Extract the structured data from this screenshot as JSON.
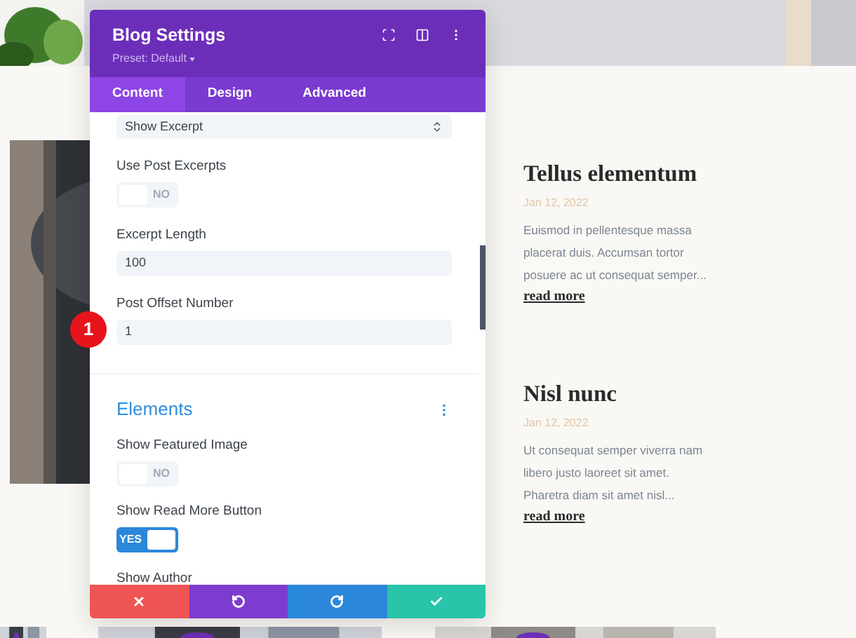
{
  "posts": [
    {
      "title": "Tellus elementum",
      "date": "Jan 12, 2022",
      "excerpt": "Euismod in pellentesque massa placerat duis. Accumsan tortor posuere ac ut consequat semper...",
      "link": "read more"
    },
    {
      "title": "Nisl nunc",
      "date": "Jan 12, 2022",
      "excerpt": "Ut consequat semper viverra nam libero justo laoreet sit amet. Pharetra diam sit amet nisl...",
      "link": "read more"
    }
  ],
  "badge": "1",
  "modal": {
    "title": "Blog Settings",
    "preset": "Preset: Default",
    "tabs": [
      {
        "label": "Content",
        "selected": true
      },
      {
        "label": "Design",
        "selected": false
      },
      {
        "label": "Advanced",
        "selected": false
      }
    ],
    "fields": [
      {
        "kind": "select",
        "value": "Show Excerpt"
      },
      {
        "kind": "toggle",
        "label": "Use Post Excerpts",
        "on": false,
        "text": "NO"
      },
      {
        "kind": "input",
        "label": "Excerpt Length",
        "value": "100"
      },
      {
        "kind": "input",
        "label": "Post Offset Number",
        "value": "1"
      },
      {
        "kind": "section",
        "label": "Elements"
      },
      {
        "kind": "toggle",
        "label": "Show Featured Image",
        "on": false,
        "text": "NO"
      },
      {
        "kind": "toggle",
        "label": "Show Read More Button",
        "on": true,
        "text": "YES"
      },
      {
        "kind": "label",
        "label": "Show Author"
      }
    ]
  }
}
